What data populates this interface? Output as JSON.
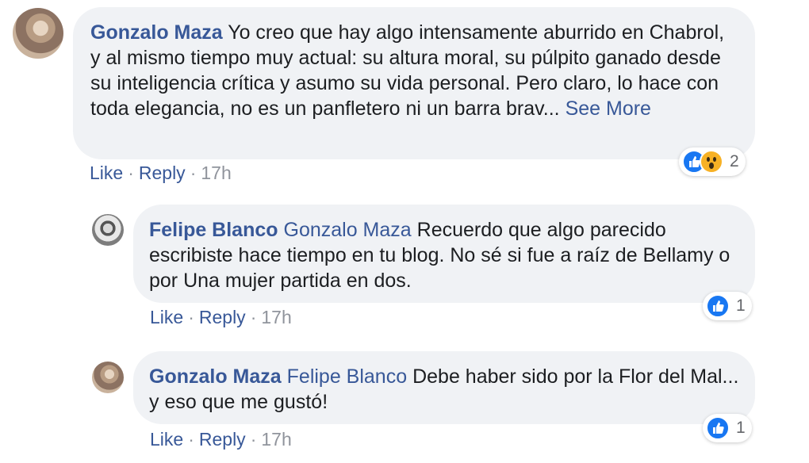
{
  "comments": [
    {
      "author": "Gonzalo Maza",
      "mention": "",
      "text": "Yo creo que hay algo intensamente aburrido en Chabrol, y al mismo tiempo muy actual: su altura moral, su púlpito ganado desde su inteligencia crítica y asumo su vida personal. Pero claro, lo hace con toda elegancia, no es un panfletero ni un barra brav...",
      "see_more": "See More",
      "like_label": "Like",
      "reply_label": "Reply",
      "time": "17h",
      "reaction_count": "2",
      "reactions": [
        "like-icon",
        "wow-icon"
      ]
    },
    {
      "author": "Felipe Blanco",
      "mention": "Gonzalo Maza",
      "text": "Recuerdo que algo parecido escribiste hace tiempo en tu blog. No sé si fue a raíz de Bellamy o por Una mujer partida en dos.",
      "like_label": "Like",
      "reply_label": "Reply",
      "time": "17h",
      "reaction_count": "1",
      "reactions": [
        "like-icon"
      ]
    },
    {
      "author": "Gonzalo Maza",
      "mention": "Felipe Blanco",
      "text": "Debe haber sido por la Flor del Mal... y eso que me gustó!",
      "like_label": "Like",
      "reply_label": "Reply",
      "time": "17h",
      "reaction_count": "1",
      "reactions": [
        "like-icon"
      ]
    }
  ],
  "separator": "·",
  "colors": {
    "link": "#385898",
    "bubble": "#f0f2f5",
    "meta": "#90949c",
    "like": "#1877f2",
    "wow": "#f7b125"
  }
}
